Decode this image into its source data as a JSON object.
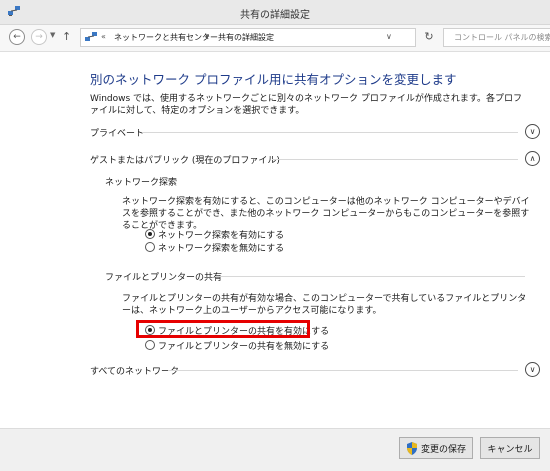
{
  "window": {
    "title": "共有の詳細設定"
  },
  "address_bar": {
    "overflow": "«",
    "breadcrumbs": [
      "ネットワークと共有センター",
      "共有の詳細設定"
    ],
    "search_placeholder": "コントロール パネルの検索"
  },
  "page": {
    "title": "別のネットワーク プロファイル用に共有オプションを変更します",
    "intro": "Windows では、使用するネットワークごとに別々のネットワーク プロファイルが作成されます。各プロファイルに対して、特定のオプションを選択できます。"
  },
  "sections": {
    "private": {
      "label": "プライベート",
      "expanded": false
    },
    "guest_public": {
      "label": "ゲストまたはパブリック (現在のプロファイル)",
      "expanded": true,
      "network_discovery": {
        "heading": "ネットワーク探索",
        "description": "ネットワーク探索を有効にすると、このコンピューターは他のネットワーク コンピューターやデバイスを参照することができ、また他のネットワーク コンピューターからもこのコンピューターを参照することができます。",
        "options": [
          {
            "label": "ネットワーク探索を有効にする",
            "checked": true
          },
          {
            "label": "ネットワーク探索を無効にする",
            "checked": false
          }
        ]
      },
      "file_printer_sharing": {
        "heading": "ファイルとプリンターの共有",
        "description": "ファイルとプリンターの共有が有効な場合、このコンピューターで共有しているファイルとプリンターは、ネットワーク上のユーザーからアクセス可能になります。",
        "options": [
          {
            "label": "ファイルとプリンターの共有を有効にする",
            "checked": true
          },
          {
            "label": "ファイルとプリンターの共有を無効にする",
            "checked": false
          }
        ]
      }
    },
    "all_networks": {
      "label": "すべてのネットワーク",
      "expanded": false
    }
  },
  "footer": {
    "save_label": "変更の保存",
    "cancel_label": "キャンセル"
  },
  "colors": {
    "title_blue": "#1e3b8a",
    "highlight_red": "#e60000"
  }
}
